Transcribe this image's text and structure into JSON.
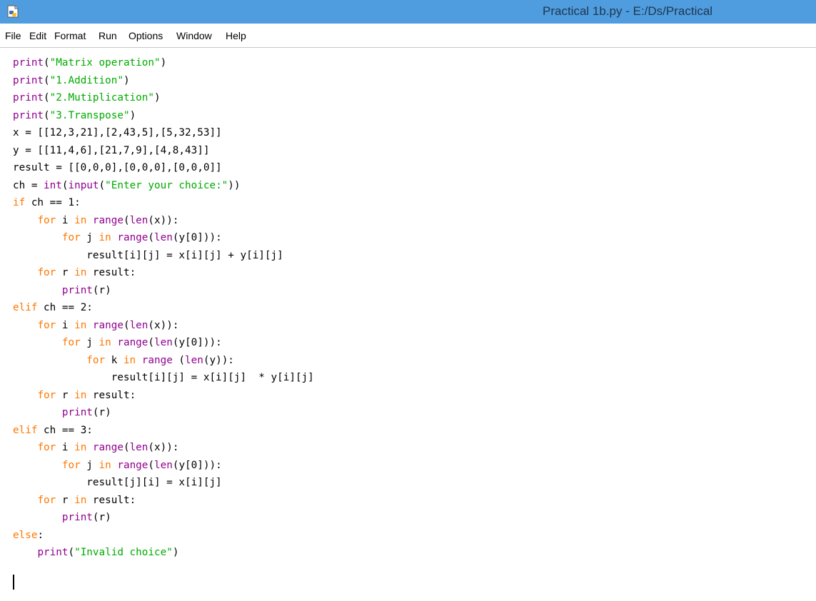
{
  "window": {
    "title": "Practical 1b.py - E:/Ds/Practical"
  },
  "icons": {
    "app": "idle-python-file-icon"
  },
  "colors": {
    "titlebar": "#4f9dde",
    "keyword": "#ff7700",
    "builtin": "#900090",
    "string": "#00aa00",
    "text": "#000000"
  },
  "menu": [
    "File",
    "Edit",
    "Format",
    "Run",
    "Options",
    "Window",
    "Help"
  ],
  "code": [
    [
      [
        "bi",
        "print"
      ],
      [
        "",
        "("
      ],
      [
        "st",
        "\"Matrix operation\""
      ],
      [
        "",
        ")"
      ]
    ],
    [
      [
        "bi",
        "print"
      ],
      [
        "",
        "("
      ],
      [
        "st",
        "\"1.Addition\""
      ],
      [
        "",
        ")"
      ]
    ],
    [
      [
        "bi",
        "print"
      ],
      [
        "",
        "("
      ],
      [
        "st",
        "\"2.Mutiplication\""
      ],
      [
        "",
        ")"
      ]
    ],
    [
      [
        "bi",
        "print"
      ],
      [
        "",
        "("
      ],
      [
        "st",
        "\"3.Transpose\""
      ],
      [
        "",
        ")"
      ]
    ],
    [
      [
        "",
        "x = [[12,3,21],[2,43,5],[5,32,53]]"
      ]
    ],
    [
      [
        "",
        "y = [[11,4,6],[21,7,9],[4,8,43]]"
      ]
    ],
    [
      [
        "",
        "result = [[0,0,0],[0,0,0],[0,0,0]]"
      ]
    ],
    [
      [
        "",
        "ch = "
      ],
      [
        "bi",
        "int"
      ],
      [
        "",
        "("
      ],
      [
        "bi",
        "input"
      ],
      [
        "",
        "("
      ],
      [
        "st",
        "\"Enter your choice:\""
      ],
      [
        "",
        "))"
      ]
    ],
    [
      [
        "kw",
        "if"
      ],
      [
        "",
        " ch == 1:"
      ]
    ],
    [
      [
        "",
        "    "
      ],
      [
        "kw",
        "for"
      ],
      [
        "",
        " i "
      ],
      [
        "kw",
        "in"
      ],
      [
        "",
        " "
      ],
      [
        "bi",
        "range"
      ],
      [
        "",
        "("
      ],
      [
        "bi",
        "len"
      ],
      [
        "",
        "(x)):"
      ]
    ],
    [
      [
        "",
        "        "
      ],
      [
        "kw",
        "for"
      ],
      [
        "",
        " j "
      ],
      [
        "kw",
        "in"
      ],
      [
        "",
        " "
      ],
      [
        "bi",
        "range"
      ],
      [
        "",
        "("
      ],
      [
        "bi",
        "len"
      ],
      [
        "",
        "(y[0])):"
      ]
    ],
    [
      [
        "",
        "            result[i][j] = x[i][j] + y[i][j]"
      ]
    ],
    [
      [
        "",
        "    "
      ],
      [
        "kw",
        "for"
      ],
      [
        "",
        " r "
      ],
      [
        "kw",
        "in"
      ],
      [
        "",
        " result:"
      ]
    ],
    [
      [
        "",
        "        "
      ],
      [
        "bi",
        "print"
      ],
      [
        "",
        "(r)"
      ]
    ],
    [
      [
        "kw",
        "elif"
      ],
      [
        "",
        " ch == 2:"
      ]
    ],
    [
      [
        "",
        "    "
      ],
      [
        "kw",
        "for"
      ],
      [
        "",
        " i "
      ],
      [
        "kw",
        "in"
      ],
      [
        "",
        " "
      ],
      [
        "bi",
        "range"
      ],
      [
        "",
        "("
      ],
      [
        "bi",
        "len"
      ],
      [
        "",
        "(x)):"
      ]
    ],
    [
      [
        "",
        "        "
      ],
      [
        "kw",
        "for"
      ],
      [
        "",
        " j "
      ],
      [
        "kw",
        "in"
      ],
      [
        "",
        " "
      ],
      [
        "bi",
        "range"
      ],
      [
        "",
        "("
      ],
      [
        "bi",
        "len"
      ],
      [
        "",
        "(y[0])):"
      ]
    ],
    [
      [
        "",
        "            "
      ],
      [
        "kw",
        "for"
      ],
      [
        "",
        " k "
      ],
      [
        "kw",
        "in"
      ],
      [
        "",
        " "
      ],
      [
        "bi",
        "range"
      ],
      [
        "",
        " ("
      ],
      [
        "bi",
        "len"
      ],
      [
        "",
        "(y)):"
      ]
    ],
    [
      [
        "",
        "                result[i][j] = x[i][j]  * y[i][j]"
      ]
    ],
    [
      [
        "",
        "    "
      ],
      [
        "kw",
        "for"
      ],
      [
        "",
        " r "
      ],
      [
        "kw",
        "in"
      ],
      [
        "",
        " result:"
      ]
    ],
    [
      [
        "",
        "        "
      ],
      [
        "bi",
        "print"
      ],
      [
        "",
        "(r)"
      ]
    ],
    [
      [
        "kw",
        "elif"
      ],
      [
        "",
        " ch == 3:"
      ]
    ],
    [
      [
        "",
        "    "
      ],
      [
        "kw",
        "for"
      ],
      [
        "",
        " i "
      ],
      [
        "kw",
        "in"
      ],
      [
        "",
        " "
      ],
      [
        "bi",
        "range"
      ],
      [
        "",
        "("
      ],
      [
        "bi",
        "len"
      ],
      [
        "",
        "(x)):"
      ]
    ],
    [
      [
        "",
        "        "
      ],
      [
        "kw",
        "for"
      ],
      [
        "",
        " j "
      ],
      [
        "kw",
        "in"
      ],
      [
        "",
        " "
      ],
      [
        "bi",
        "range"
      ],
      [
        "",
        "("
      ],
      [
        "bi",
        "len"
      ],
      [
        "",
        "(y[0])):"
      ]
    ],
    [
      [
        "",
        "            result[j][i] = x[i][j]"
      ]
    ],
    [
      [
        "",
        "    "
      ],
      [
        "kw",
        "for"
      ],
      [
        "",
        " r "
      ],
      [
        "kw",
        "in"
      ],
      [
        "",
        " result:"
      ]
    ],
    [
      [
        "",
        "        "
      ],
      [
        "bi",
        "print"
      ],
      [
        "",
        "(r)"
      ]
    ],
    [
      [
        "kw",
        "else"
      ],
      [
        "",
        ":"
      ]
    ],
    [
      [
        "",
        "    "
      ],
      [
        "bi",
        "print"
      ],
      [
        "",
        "("
      ],
      [
        "st",
        "\"Invalid choice\""
      ],
      [
        "",
        ")"
      ]
    ]
  ]
}
